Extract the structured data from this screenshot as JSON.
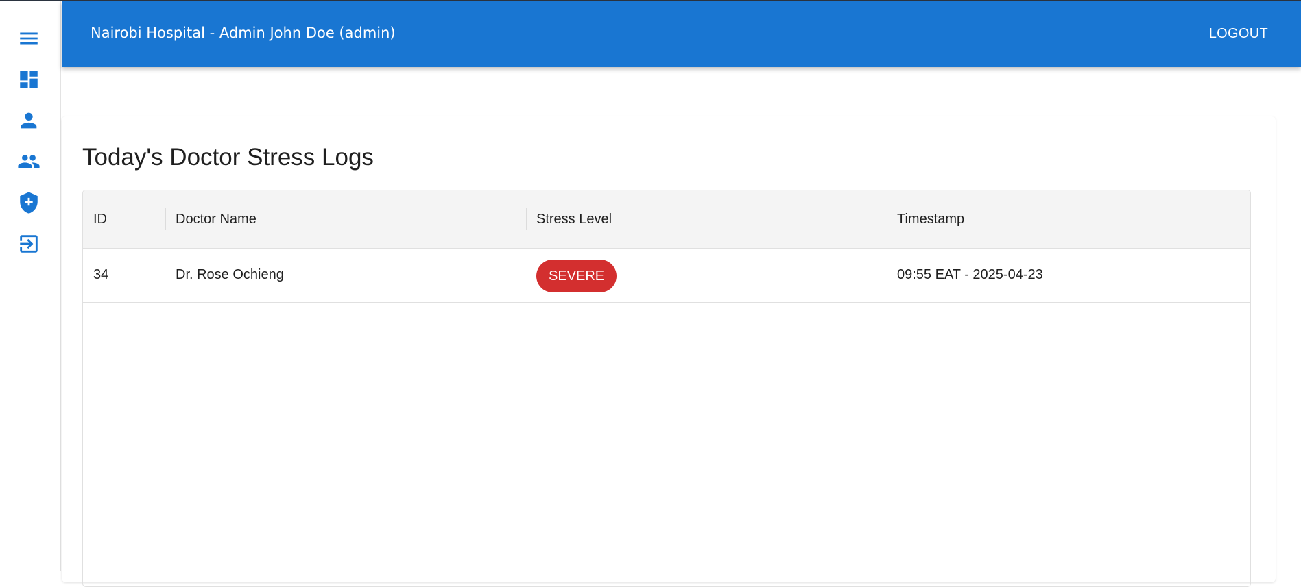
{
  "header": {
    "title": "Nairobi Hospital - Admin John Doe (admin)",
    "logout_label": "LOGOUT"
  },
  "sidebar": {
    "items": [
      {
        "icon": "menu-icon"
      },
      {
        "icon": "dashboard-icon"
      },
      {
        "icon": "person-icon"
      },
      {
        "icon": "people-icon"
      },
      {
        "icon": "shield-plus-icon"
      },
      {
        "icon": "logout-icon"
      }
    ],
    "accent": "#1976d2"
  },
  "page": {
    "title": "Today's Doctor Stress Logs"
  },
  "table": {
    "columns": [
      "ID",
      "Doctor Name",
      "Stress Level",
      "Timestamp"
    ],
    "rows": [
      {
        "id": "34",
        "doctor": "Dr. Rose Ochieng",
        "stress_level": "SEVERE",
        "stress_color": "#d32f2f",
        "timestamp": "09:55 EAT - 2025-04-23"
      }
    ]
  },
  "colors": {
    "appbar": "#1976d2",
    "severe": "#d32f2f"
  }
}
